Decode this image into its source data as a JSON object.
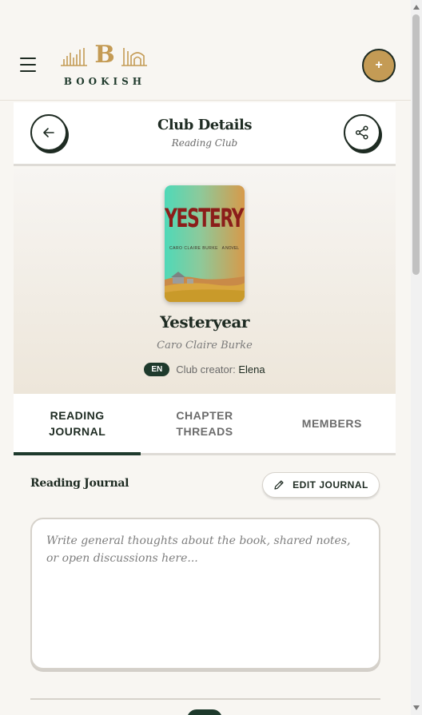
{
  "header": {
    "logo_letter": "B",
    "logo_text": "BOOKISH",
    "add_label": "+"
  },
  "detail": {
    "title": "Club Details",
    "subtitle": "Reading Club"
  },
  "book": {
    "cover_title": "YESTERYEAR",
    "cover_author": "CARO CLAIRE BURKE",
    "cover_tag": "A NOVEL",
    "title": "Yesteryear",
    "author": "Caro Claire Burke",
    "language": "EN",
    "creator_label": "Club creator:",
    "creator_name": "Elena"
  },
  "tabs": [
    {
      "label": "READING JOURNAL",
      "line1": "READING",
      "line2": "JOURNAL",
      "active": true
    },
    {
      "label": "CHAPTER THREADS",
      "line1": "CHAPTER",
      "line2": "THREADS",
      "active": false
    },
    {
      "label": "MEMBERS",
      "line1": "MEMBERS",
      "line2": "",
      "active": false
    }
  ],
  "journal": {
    "section_title": "Reading Journal",
    "edit_label": "EDIT JOURNAL",
    "placeholder": "Write general thoughts about the book, shared notes, or open discussions here..."
  },
  "colors": {
    "brand_green": "#1e3a2c",
    "gold": "#c49b55",
    "background": "#f8f6f2"
  }
}
